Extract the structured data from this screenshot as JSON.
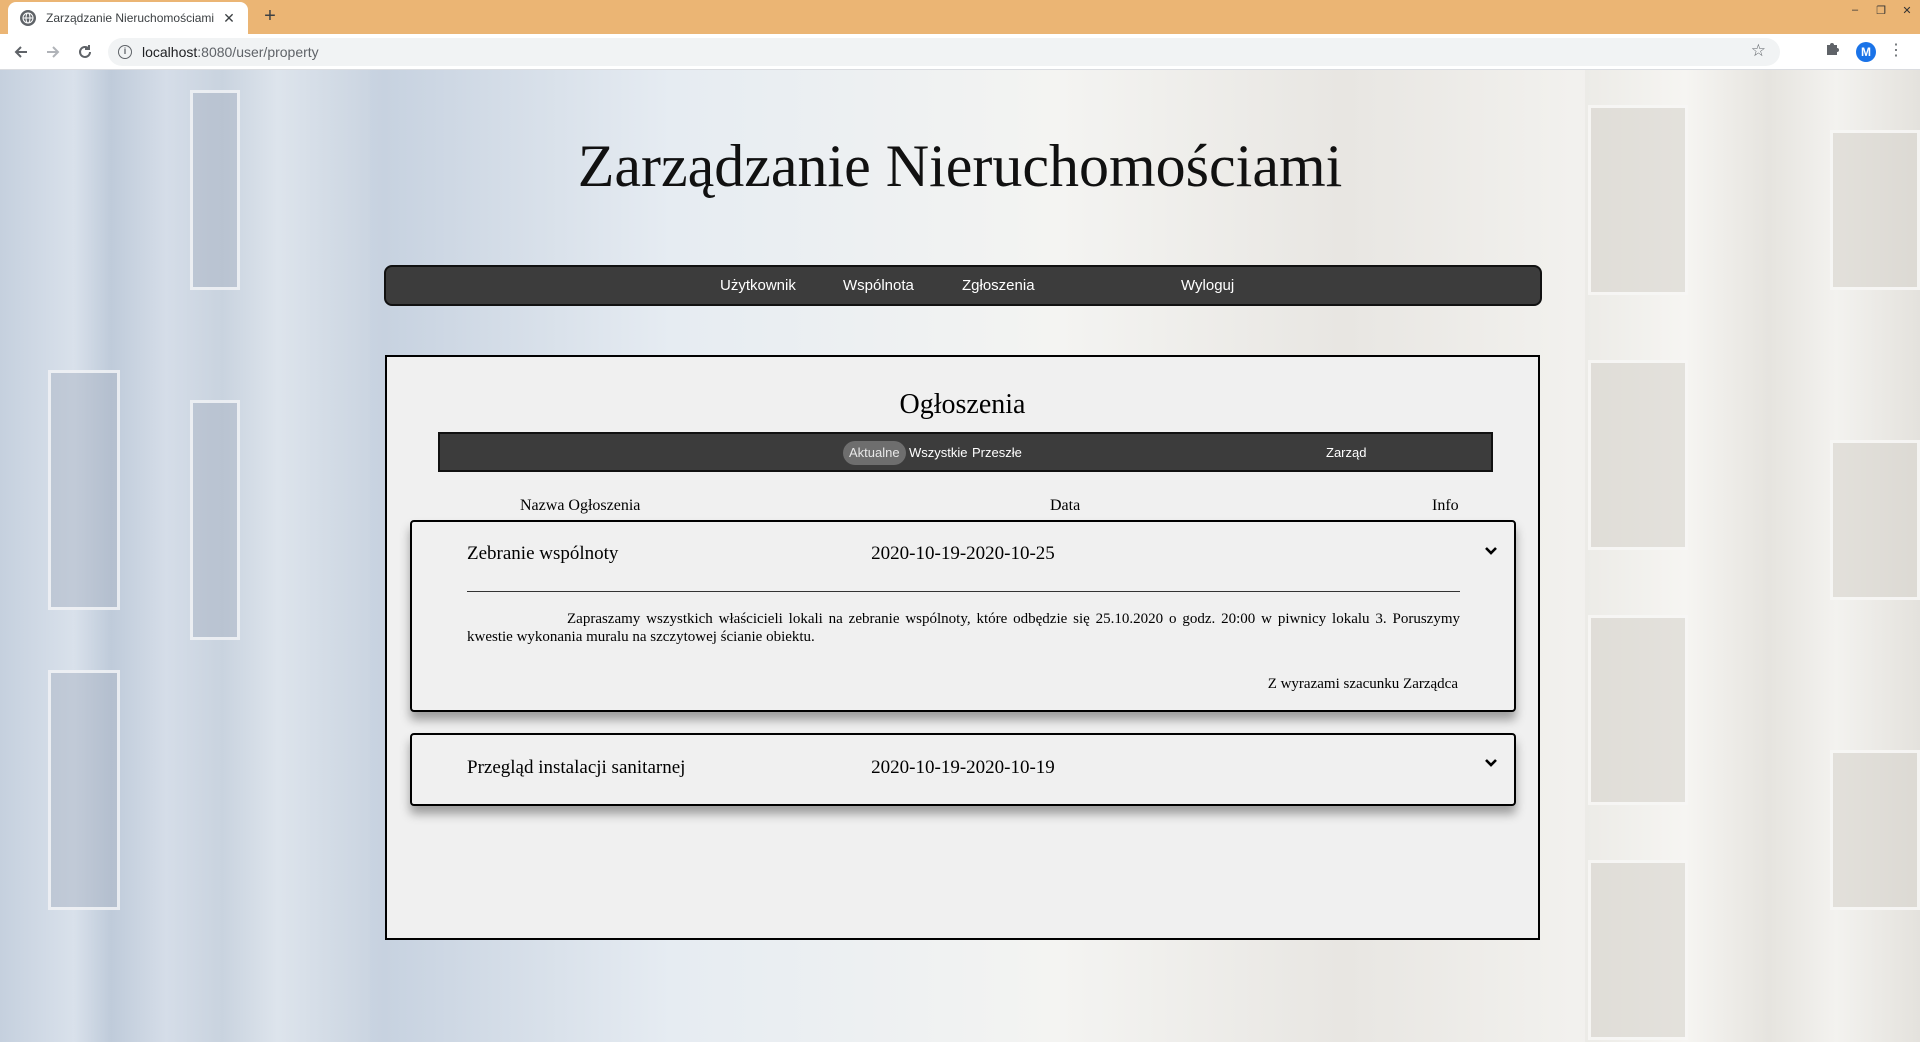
{
  "browser": {
    "tab_title": "Zarządzanie Nieruchomościami",
    "tab_close": "✕",
    "new_tab": "+",
    "url_host": "localhost",
    "url_rest": ":8080/user/property",
    "avatar_letter": "M",
    "window_controls": [
      "–",
      "❐",
      "✕"
    ]
  },
  "page": {
    "title": "Zarządzanie Nieruchomościami",
    "nav": {
      "user": "Użytkownik",
      "community": "Wspólnota",
      "reports": "Zgłoszenia",
      "logout": "Wyloguj"
    }
  },
  "announcements": {
    "heading": "Ogłoszenia",
    "filters": {
      "current": "Aktualne",
      "all": "Wszystkie",
      "past": "Przeszłe",
      "board": "Zarząd"
    },
    "active_filter": "Aktualne",
    "columns": {
      "name": "Nazwa Ogłoszenia",
      "date": "Data",
      "info": "Info"
    },
    "items": [
      {
        "name": "Zebranie wspólnoty",
        "date": "2020-10-19-2020-10-25",
        "expanded": true,
        "body": "Zapraszamy wszystkich właścicieli lokali na zebranie wspólnoty, które odbędzie się 25.10.2020 o godz. 20:00 w piwnicy lokalu 3. Poruszymy kwestie wykonania muralu na szczytowej ścianie obiektu.",
        "signature": "Z wyrazami szacunku Zarządca"
      },
      {
        "name": "Przegląd instalacji sanitarnej",
        "date": "2020-10-19-2020-10-19",
        "expanded": false
      }
    ]
  },
  "colors": {
    "titlebar": "#ebb574",
    "nav_bg": "#3c3c3c",
    "panel_bg": "#f0f0f0",
    "active_filter_bg": "#6e6e6e"
  }
}
